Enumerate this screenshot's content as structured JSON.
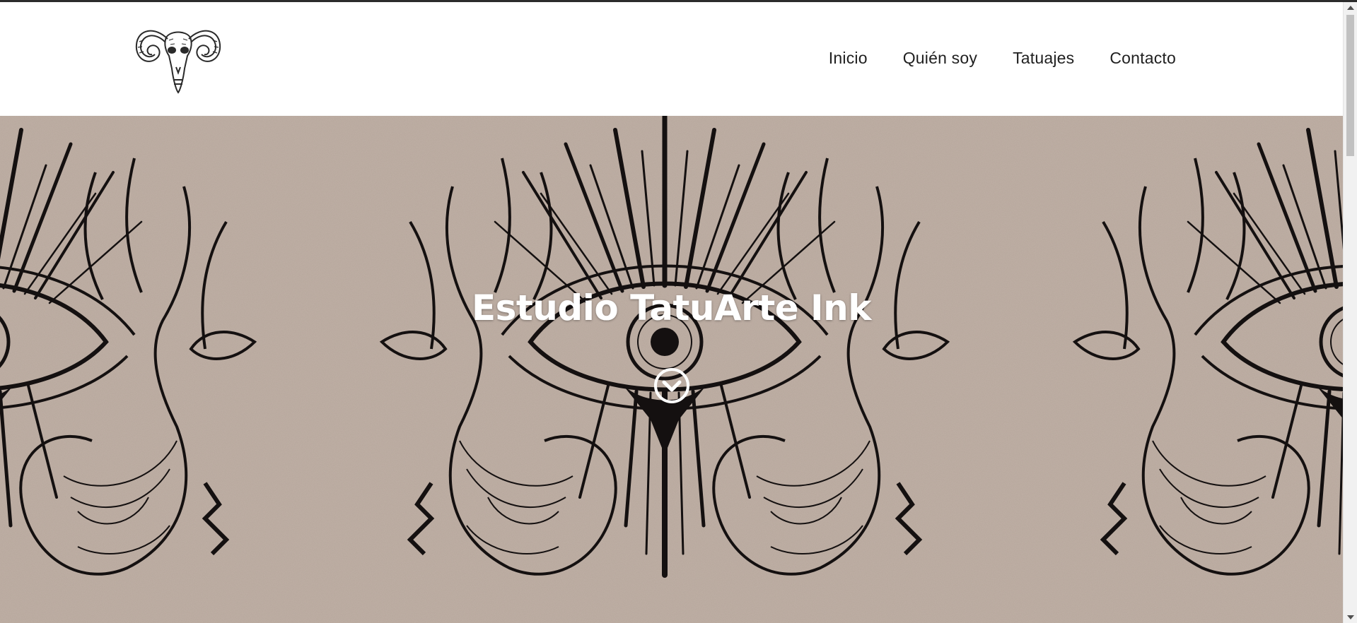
{
  "header": {
    "logo_icon": "ram-skull-logo",
    "nav": [
      {
        "label": "Inicio"
      },
      {
        "label": "Quién soy"
      },
      {
        "label": "Tatuajes"
      },
      {
        "label": "Contacto"
      }
    ]
  },
  "hero": {
    "title": "Estudio TatuArte Ink",
    "background_icon": "eye-hands-illustration",
    "scroll_icon": "chevron-down-circle-icon",
    "background_color": "#b7a79c",
    "ink_color": "#141010"
  },
  "colors": {
    "header_bg": "#ffffff",
    "nav_text": "#1f1f1f",
    "title_text": "#ffffff"
  }
}
